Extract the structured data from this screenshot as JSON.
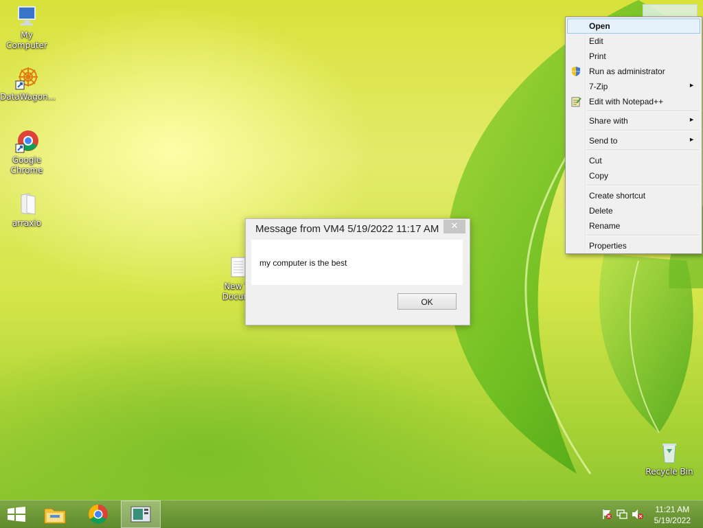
{
  "desktop": {
    "icons": [
      {
        "label": "My Computer",
        "icon": "computer-icon"
      },
      {
        "label": "DataWagon...",
        "icon": "datawagon-icon"
      },
      {
        "label": "Google Chrome",
        "icon": "chrome-icon"
      },
      {
        "label": "arraxio",
        "icon": "folder-icon"
      },
      {
        "label": "New T\nDocum",
        "icon": "text-document-icon"
      },
      {
        "label": "Recycle Bin",
        "icon": "recycle-bin-icon"
      }
    ]
  },
  "dialog": {
    "title": "Message from VM4 5/19/2022 11:17 AM",
    "close": "✕",
    "message": "my computer is the best",
    "ok_label": "OK"
  },
  "context_menu": {
    "items": [
      {
        "label": "Open",
        "highlighted": true
      },
      {
        "label": "Edit"
      },
      {
        "label": "Print"
      },
      {
        "label": "Run as administrator",
        "icon": "uac-shield-icon"
      },
      {
        "label": "7-Zip",
        "submenu": true
      },
      {
        "label": "Edit with Notepad++",
        "icon": "notepadpp-icon"
      },
      {
        "label": "Share with",
        "submenu": true
      },
      {
        "label": "Send to",
        "submenu": true
      },
      {
        "label": "Cut"
      },
      {
        "label": "Copy"
      },
      {
        "label": "Create shortcut"
      },
      {
        "label": "Delete"
      },
      {
        "label": "Rename"
      },
      {
        "label": "Properties"
      }
    ],
    "arrow": "►"
  },
  "taskbar": {
    "buttons": [
      {
        "icon": "windows-start-icon"
      },
      {
        "icon": "file-explorer-icon"
      },
      {
        "icon": "chrome-icon"
      },
      {
        "icon": "remote-desktop-icon",
        "active": true
      }
    ],
    "tray": {
      "icons": [
        "action-center-flag-icon",
        "network-icon",
        "volume-muted-icon"
      ],
      "time": "11:21 AM",
      "date": "5/19/2022"
    }
  },
  "colors": {
    "menu_highlight": "#e5f1fb",
    "taskbar": "#6e9a36"
  }
}
